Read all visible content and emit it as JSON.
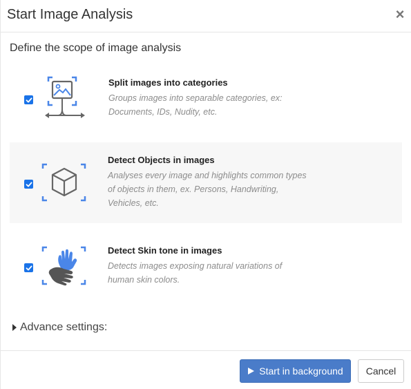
{
  "dialog": {
    "title": "Start Image Analysis",
    "close_icon": "close-icon",
    "scope_label": "Define the scope of image analysis"
  },
  "options": [
    {
      "checked": true,
      "icon": "image-split-icon",
      "title": "Split images into categories",
      "description": "Groups images into separable categories, ex:\nDocuments, IDs, Nudity, etc."
    },
    {
      "checked": true,
      "icon": "cube-icon",
      "title": "Detect Objects in images",
      "description": "Analyses every image and highlights common types\nof objects in them, ex. Persons, Handwriting,\nVehicles, etc."
    },
    {
      "checked": true,
      "icon": "hands-icon",
      "title": "Detect Skin tone in images",
      "description": "Detects images exposing natural variations of\nhuman skin colors."
    }
  ],
  "advance": {
    "label": "Advance settings:",
    "icon": "caret-right-icon"
  },
  "footer": {
    "start_label": "Start in background",
    "start_icon": "play-icon",
    "cancel_label": "Cancel"
  },
  "colors": {
    "accent": "#4a7cc9",
    "checkbox": "#1a73e8",
    "icon_blue": "#4a86e8",
    "icon_gray": "#666666"
  }
}
